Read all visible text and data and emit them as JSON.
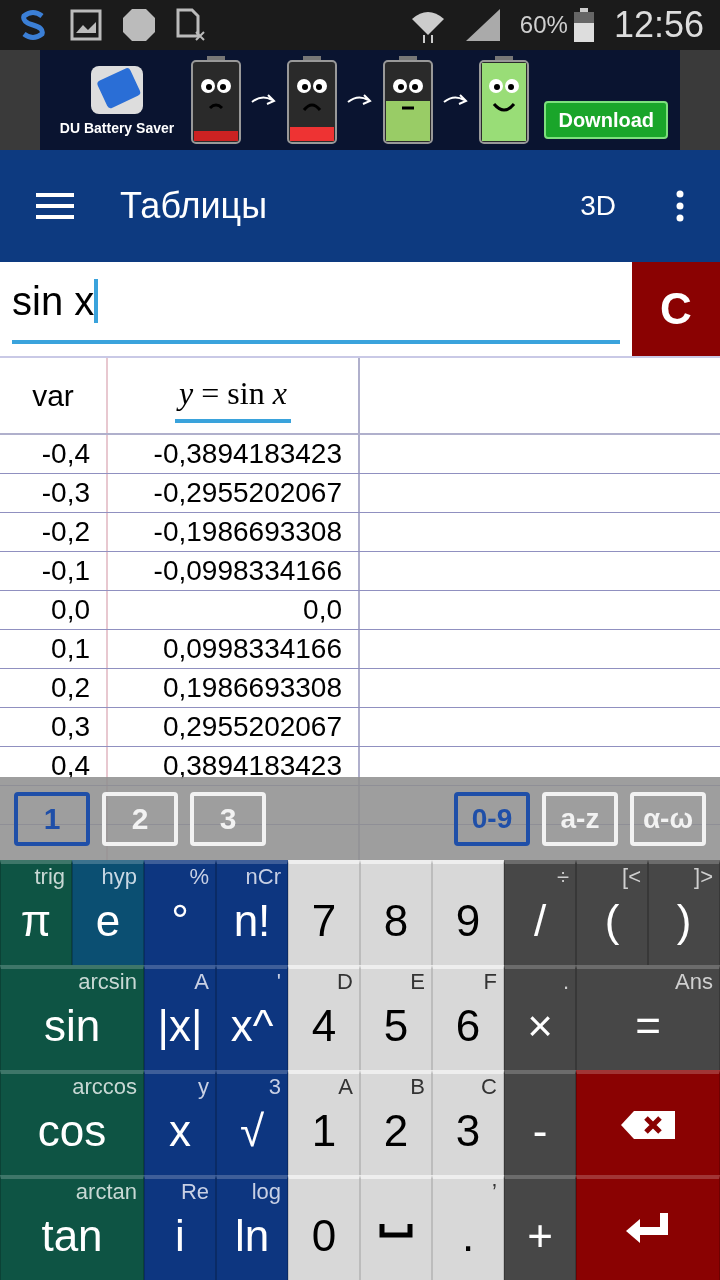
{
  "status_bar": {
    "battery": "60%",
    "time": "12:56"
  },
  "ad": {
    "app_name": "DU Battery Saver",
    "button": "Download"
  },
  "app_bar": {
    "title": "Таблицы",
    "action": "3D"
  },
  "input": {
    "value": "sin x",
    "clear_button": "C"
  },
  "table": {
    "columns": [
      "var",
      "*y* = sin *x*"
    ],
    "rows": [
      [
        "-0,4",
        "-0,3894183423"
      ],
      [
        "-0,3",
        "-0,2955202067"
      ],
      [
        "-0,2",
        "-0,1986693308"
      ],
      [
        "-0,1",
        "-0,0998334166"
      ],
      [
        "0,0",
        "0,0"
      ],
      [
        "0,1",
        "0,0998334166"
      ],
      [
        "0,2",
        "0,1986693308"
      ],
      [
        "0,3",
        "0,2955202067"
      ],
      [
        "0,4",
        "0,3894183423"
      ]
    ]
  },
  "keyboard_tabs": {
    "pages": [
      {
        "label": "1",
        "selected": true
      },
      {
        "label": "2",
        "selected": false
      },
      {
        "label": "3",
        "selected": false
      }
    ],
    "modes": [
      {
        "label": "0-9",
        "selected": true
      },
      {
        "label": "a-z",
        "selected": false
      },
      {
        "label": "α-ω",
        "selected": false
      }
    ]
  },
  "keypad": [
    [
      {
        "kind": "green",
        "main": "π",
        "sub": "trig"
      },
      {
        "kind": "teal",
        "main": "e",
        "sub": "hyp"
      },
      {
        "kind": "blue",
        "main": "°",
        "sub": "%"
      },
      {
        "kind": "blue",
        "main": "n!",
        "sub": "nCr"
      },
      {
        "kind": "light",
        "main": "7"
      },
      {
        "kind": "light",
        "main": "8"
      },
      {
        "kind": "light",
        "main": "9"
      },
      {
        "kind": "dark",
        "main": "/",
        "sub": "÷"
      },
      {
        "kind": "dark",
        "main": "(",
        "sub": "[<"
      },
      {
        "kind": "dark",
        "main": ")",
        "sub": "]>"
      }
    ],
    [
      {
        "kind": "green",
        "main": "sin",
        "sub": "arcsin",
        "wide": true
      },
      {
        "kind": "blue",
        "main": "|x|",
        "sub": "A"
      },
      {
        "kind": "blue",
        "main": "x^",
        "sub": "'"
      },
      {
        "kind": "light",
        "main": "4",
        "sub": "D"
      },
      {
        "kind": "light",
        "main": "5",
        "sub": "E"
      },
      {
        "kind": "light",
        "main": "6",
        "sub": "F"
      },
      {
        "kind": "dark",
        "main": "×",
        "sub": "."
      },
      {
        "kind": "dark",
        "main": "=",
        "sub": "Ans",
        "wide": true
      }
    ],
    [
      {
        "kind": "green",
        "main": "cos",
        "sub": "arccos",
        "wide": true
      },
      {
        "kind": "blue",
        "main": "x",
        "sub": "y"
      },
      {
        "kind": "blue",
        "main": "√",
        "sub": "3"
      },
      {
        "kind": "light",
        "main": "1",
        "sub": "A"
      },
      {
        "kind": "light",
        "main": "2",
        "sub": "B"
      },
      {
        "kind": "light",
        "main": "3",
        "sub": "C"
      },
      {
        "kind": "dark",
        "main": "-"
      },
      {
        "kind": "backspace",
        "wide": true
      }
    ],
    [
      {
        "kind": "green",
        "main": "tan",
        "sub": "arctan",
        "wide": true
      },
      {
        "kind": "blue",
        "main": "i",
        "sub": "Re"
      },
      {
        "kind": "blue",
        "main": "ln",
        "sub": "log"
      },
      {
        "kind": "light",
        "main": "0"
      },
      {
        "kind": "space"
      },
      {
        "kind": "light",
        "main": ".",
        "sub": "’"
      },
      {
        "kind": "dark",
        "main": "+"
      },
      {
        "kind": "enter",
        "wide": true
      }
    ]
  ]
}
